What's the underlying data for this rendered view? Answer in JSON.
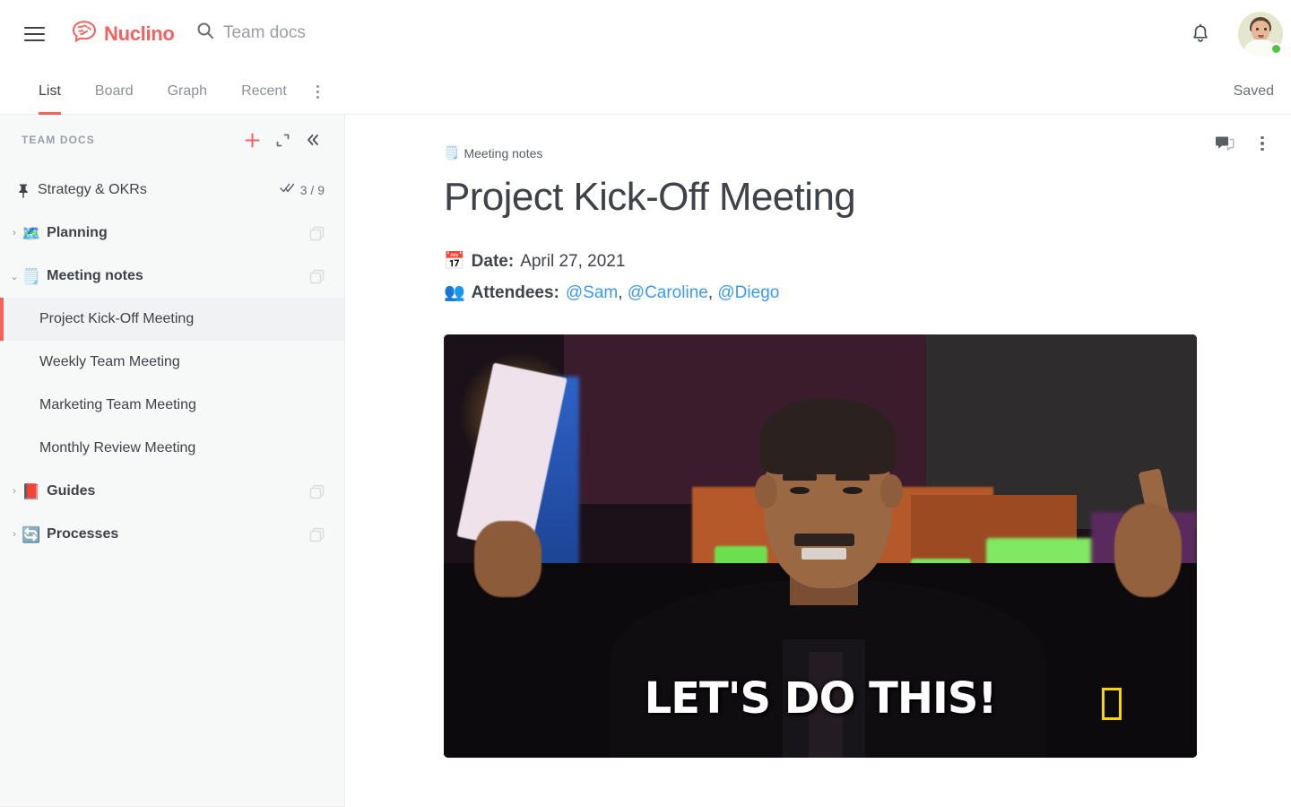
{
  "app": {
    "brand_name": "Nuclino",
    "brand_color": "#f4615f",
    "logo_icon": "brain-speech-bubble-icon",
    "menu_icon": "hamburger-menu-icon"
  },
  "search": {
    "icon": "search-icon",
    "value": "Team docs",
    "placeholder": "Team docs"
  },
  "header": {
    "notification_icon": "bell-icon",
    "avatar_icon": "user-avatar",
    "status": "online",
    "status_color": "#4fc53f"
  },
  "tabs": {
    "items": [
      {
        "label": "List",
        "active": true
      },
      {
        "label": "Board",
        "active": false
      },
      {
        "label": "Graph",
        "active": false
      },
      {
        "label": "Recent",
        "active": false
      }
    ],
    "more_icon": "more-vertical-icon",
    "save_status": "Saved"
  },
  "sidebar": {
    "title": "TEAM DOCS",
    "actions": [
      {
        "name": "add-icon",
        "glyph": "+"
      },
      {
        "name": "expand-icon",
        "glyph": "⤢"
      },
      {
        "name": "collapse-sidebar-icon",
        "glyph": "«"
      }
    ],
    "pinned": {
      "label": "Strategy & OKRs",
      "icon": "pin-icon",
      "check_icon": "double-check-icon",
      "count": "3 / 9"
    },
    "tree": [
      {
        "label": "Planning",
        "emoji": "🗺️",
        "emoji_name": "world-map-icon",
        "caret": "›",
        "expanded": false,
        "cluster_icon": "cluster-icon",
        "children": []
      },
      {
        "label": "Meeting notes",
        "emoji": "🗒️",
        "emoji_name": "spiral-notepad-icon",
        "caret": "⌄",
        "expanded": true,
        "cluster_icon": "cluster-icon",
        "children": [
          {
            "label": "Project Kick-Off Meeting",
            "active": true
          },
          {
            "label": "Weekly Team Meeting",
            "active": false
          },
          {
            "label": "Marketing Team Meeting",
            "active": false
          },
          {
            "label": "Monthly Review Meeting",
            "active": false
          }
        ]
      },
      {
        "label": "Guides",
        "emoji": "📕",
        "emoji_name": "closed-book-icon",
        "caret": "›",
        "expanded": false,
        "cluster_icon": "cluster-icon",
        "children": []
      },
      {
        "label": "Processes",
        "emoji": "🔄",
        "emoji_name": "arrows-counterclockwise-icon",
        "caret": "›",
        "expanded": false,
        "cluster_icon": "cluster-icon",
        "children": []
      }
    ]
  },
  "document": {
    "toolbar": [
      {
        "name": "comments-icon",
        "label": "Comments"
      },
      {
        "name": "more-vertical-icon",
        "label": "More"
      }
    ],
    "breadcrumb": {
      "emoji": "🗒️",
      "emoji_name": "spiral-notepad-icon",
      "label": "Meeting notes"
    },
    "title": "Project Kick-Off Meeting",
    "meta": [
      {
        "emoji": "📅",
        "emoji_name": "calendar-icon",
        "key": "Date:",
        "value": "April 27, 2021",
        "mentions": []
      },
      {
        "emoji": "👥",
        "emoji_name": "busts-in-silhouette-icon",
        "key": "Attendees:",
        "value": "",
        "mentions": [
          "@Sam",
          "@Caroline",
          "@Diego"
        ],
        "mention_color": "#3c9ae8"
      }
    ],
    "embed": {
      "type": "gif",
      "caption": "LET'S DO THIS!",
      "watermark": "National Geographic",
      "watermark_color": "#f5d800"
    }
  }
}
